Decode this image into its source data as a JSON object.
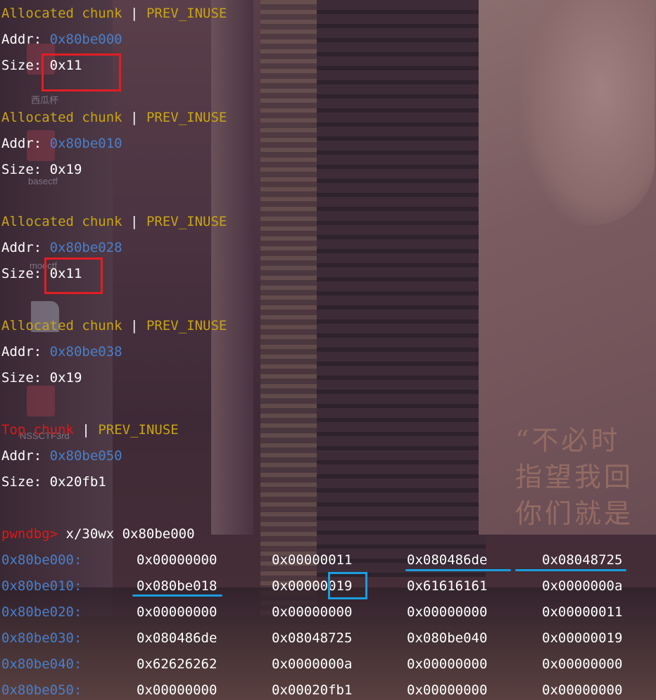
{
  "chunks": [
    {
      "type_label": "Allocated chunk",
      "flag": "PREV_INUSE",
      "addr_label": "Addr:",
      "addr": "0x80be000",
      "size_label": "Size:",
      "size": "0x11"
    },
    {
      "type_label": "Allocated chunk",
      "flag": "PREV_INUSE",
      "addr_label": "Addr:",
      "addr": "0x80be010",
      "size_label": "Size:",
      "size": "0x19"
    },
    {
      "type_label": "Allocated chunk",
      "flag": "PREV_INUSE",
      "addr_label": "Addr:",
      "addr": "0x80be028",
      "size_label": "Size:",
      "size": "0x11"
    },
    {
      "type_label": "Allocated chunk",
      "flag": "PREV_INUSE",
      "addr_label": "Addr:",
      "addr": "0x80be038",
      "size_label": "Size:",
      "size": "0x19"
    },
    {
      "type_label": "Top chunk",
      "flag": "PREV_INUSE",
      "addr_label": "Addr:",
      "addr": "0x80be050",
      "size_label": "Size:",
      "size": "0x20fb1"
    }
  ],
  "separator": "|",
  "prompt": {
    "label": "pwndbg>",
    "command": "x/30wx 0x80be000"
  },
  "memory_rows": [
    {
      "addr": "0x80be000:",
      "words": [
        "0x00000000",
        "0x00000011",
        "0x080486de",
        "0x08048725"
      ]
    },
    {
      "addr": "0x80be010:",
      "words": [
        "0x080be018",
        "0x00000019",
        "0x61616161",
        "0x0000000a"
      ]
    },
    {
      "addr": "0x80be020:",
      "words": [
        "0x00000000",
        "0x00000000",
        "0x00000000",
        "0x00000011"
      ]
    },
    {
      "addr": "0x80be030:",
      "words": [
        "0x080486de",
        "0x08048725",
        "0x080be040",
        "0x00000019"
      ]
    },
    {
      "addr": "0x80be040:",
      "words": [
        "0x62626262",
        "0x0000000a",
        "0x00000000",
        "0x00000000"
      ]
    },
    {
      "addr": "0x80be050:",
      "words": [
        "0x00000000",
        "0x00020fb1",
        "0x00000000",
        "0x00000000"
      ]
    }
  ],
  "desktop_icons": [
    "西瓜杯",
    "basectf",
    "moectf",
    "NSSCTF3rd"
  ],
  "poster_text": [
    "“不必时",
    "指望我回",
    "你们就是"
  ],
  "colors": {
    "yellow": "#c8a414",
    "blue": "#4a7fc8",
    "red": "#e01818",
    "highlight_red": "#e21d24",
    "highlight_blue": "#1a9ee0"
  }
}
